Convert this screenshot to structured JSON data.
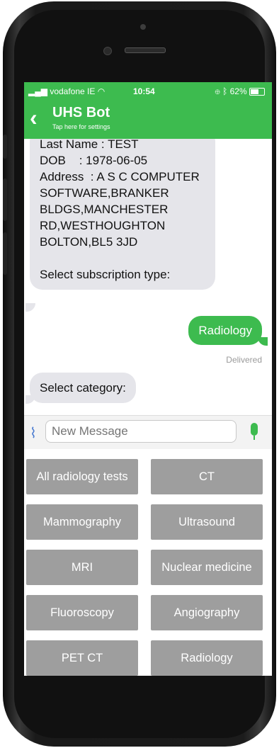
{
  "status": {
    "carrier": "vodafone IE",
    "time": "10:54",
    "battery": "62%",
    "battery_level": 0.62
  },
  "header": {
    "back_label": "‹",
    "title": "UHS Bot",
    "subtitle": "Tap here for settings"
  },
  "messages": {
    "profile_lines": [
      "Last Name : TEST",
      "DOB    : 1978-06-05",
      "Address  : A S C COMPUTER",
      "SOFTWARE,BRANKER",
      "BLDGS,MANCHESTER",
      "RD,WESTHOUGHTON",
      "BOLTON,BL5 3JD",
      "",
      "Select subscription type:"
    ],
    "reply": "Radiology",
    "delivered": "Delivered",
    "category_prompt": "Select category:"
  },
  "composer": {
    "placeholder": "New Message"
  },
  "options": [
    "All radiology tests",
    "CT",
    "Mammography",
    "Ultrasound",
    "MRI",
    "Nuclear medicine",
    "Fluoroscopy",
    "Angiography",
    "PET CT",
    "Radiology"
  ],
  "colors": {
    "accent": "#3dbb4f",
    "incoming_bubble": "#e5e5ea",
    "option_button": "#9e9e9e"
  }
}
